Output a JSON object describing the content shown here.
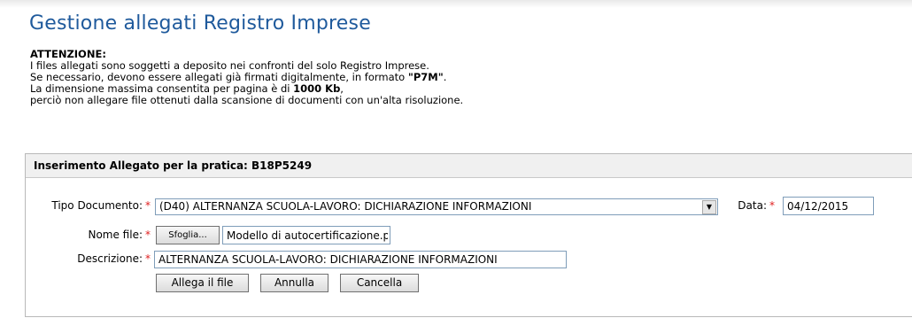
{
  "page": {
    "title": "Gestione allegati Registro Imprese"
  },
  "notice": {
    "heading": "ATTENZIONE:",
    "line1": "I files allegati sono soggetti a deposito nei confronti del solo Registro Imprese.",
    "line2_pre": "Se necessario, devono essere allegati già firmati digitalmente, in formato ",
    "line2_bold": "\"P7M\"",
    "line2_post": ".",
    "line3_pre": "La dimensione massima consentita per pagina è di ",
    "line3_bold": "1000 Kb",
    "line3_post": ",",
    "line4": "perciò non allegare file ottenuti dalla scansione di documenti con un'alta risoluzione."
  },
  "form": {
    "header": "Inserimento Allegato per la pratica: B18P5249",
    "tipo_label": "Tipo Documento:",
    "tipo_value": "(D40) ALTERNANZA SCUOLA-LAVORO: DICHIARAZIONE INFORMAZIONI",
    "data_label": "Data:",
    "data_value": "04/12/2015",
    "nome_label": "Nome file:",
    "browse_label": "Sfoglia...",
    "file_value": "Modello di autocertificazione.pdf",
    "descr_label": "Descrizione:",
    "descr_value": "ALTERNANZA SCUOLA-LAVORO: DICHIARAZIONE INFORMAZIONI",
    "required_mark": "*",
    "dropdown_arrow": "▼"
  },
  "buttons": {
    "allega": "Allega il file",
    "annulla": "Annulla",
    "cancella": "Cancella"
  }
}
